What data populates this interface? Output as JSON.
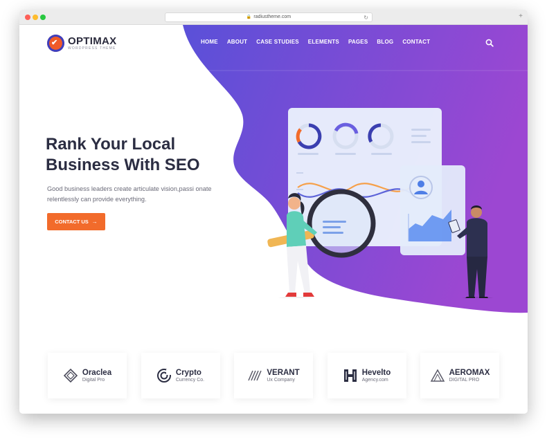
{
  "browser": {
    "url": "radiustheme.com"
  },
  "header": {
    "logo_name": "OPTIMAX",
    "logo_tagline": "WORDPRESS THEME",
    "nav": [
      "HOME",
      "ABOUT",
      "CASE STUDIES",
      "ELEMENTS",
      "PAGES",
      "BLOG",
      "CONTACT"
    ]
  },
  "hero": {
    "title_line1": "Rank Your Local",
    "title_line2": "Business With SEO",
    "description_line1": "Good business leaders create articulate vision,passi onate",
    "description_line2": "relentlessly can provide everything.",
    "cta_label": "CONTACT US",
    "cta_arrow": "→"
  },
  "brands": [
    {
      "name": "Oraclea",
      "sub": "Digital Pro",
      "icon": "diamond-logo-icon"
    },
    {
      "name": "Crypto",
      "sub": "Currency Co.",
      "icon": "spiral-logo-icon"
    },
    {
      "name": "VERANT",
      "sub": "Ux Company",
      "icon": "stripes-logo-icon"
    },
    {
      "name": "Hevelto",
      "sub": "Agency.com",
      "icon": "h-logo-icon"
    },
    {
      "name": "AEROMAX",
      "sub": "DIGITAL PRO",
      "icon": "triangle-logo-icon"
    }
  ],
  "colors": {
    "gradient_start": "#5b4fd6",
    "gradient_end": "#9b47d1",
    "accent": "#f26b2b",
    "heading": "#2b2d42"
  }
}
